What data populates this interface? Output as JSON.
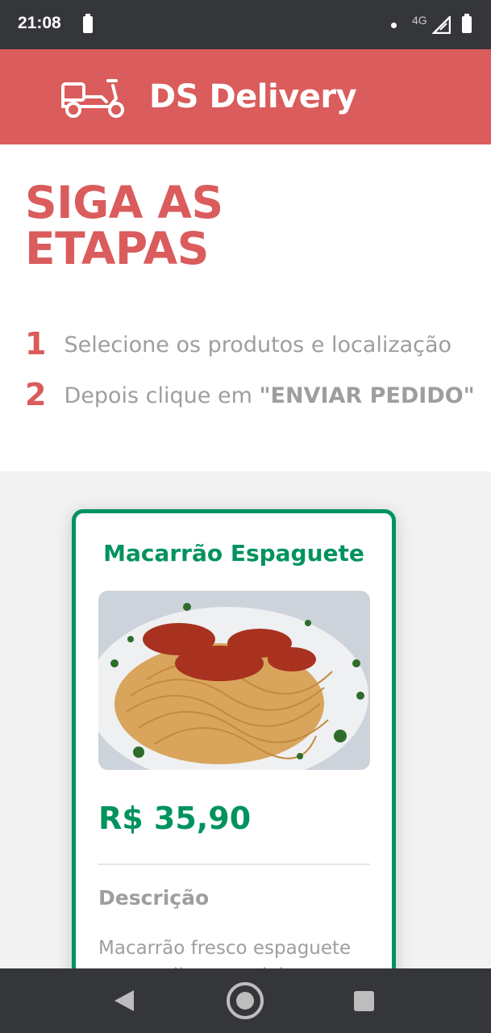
{
  "status_bar": {
    "time": "21:08",
    "network": "4G"
  },
  "navbar": {
    "brand": "DS Delivery",
    "logo_icon": "scooter-icon",
    "background": "#da5c5c"
  },
  "home": {
    "title": "SIGA AS ETAPAS",
    "steps": [
      {
        "number": "1",
        "text": "Selecione os produtos e localização"
      },
      {
        "number": "2",
        "text": "Depois clique em ",
        "emphasis": "\"ENVIAR PEDIDO\""
      }
    ]
  },
  "product": {
    "name": "Macarrão Espaguete",
    "image_alt": "spaghetti-with-shrimp-image",
    "price": "R$ 35,90",
    "description_title": "Descrição",
    "description": "Macarrão fresco espaguete com molho especial e camarões",
    "accent": "#00935e"
  },
  "navigation_bar": {
    "back_icon": "back-triangle-icon",
    "home_icon": "home-circle-icon",
    "recent_icon": "recent-apps-square-icon"
  }
}
